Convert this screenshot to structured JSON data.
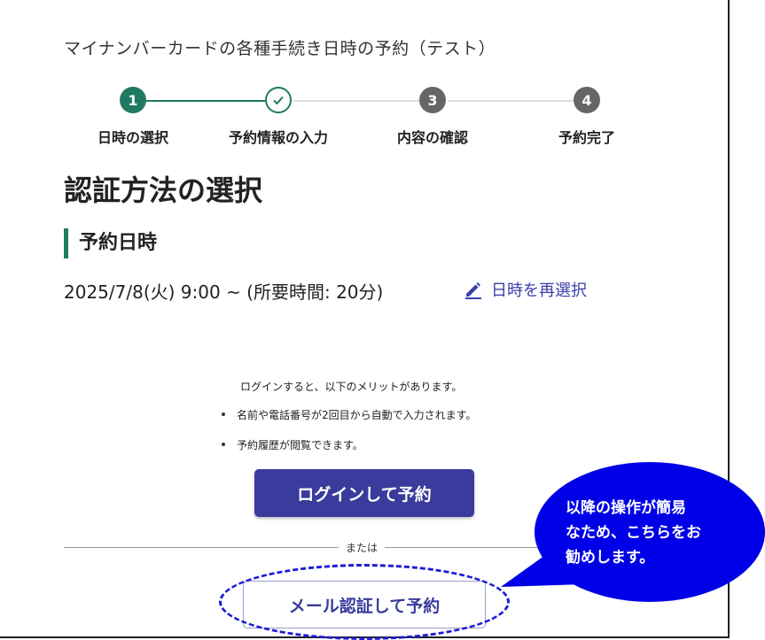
{
  "app": {
    "title": "マイナンバーカードの各種手続き日時の予約（テスト）"
  },
  "stepper": {
    "steps": [
      {
        "number": "1",
        "label": "日時の選択",
        "state": "current"
      },
      {
        "number": "",
        "label": "予約情報の入力",
        "state": "completed"
      },
      {
        "number": "3",
        "label": "内容の確認",
        "state": "upcoming"
      },
      {
        "number": "4",
        "label": "予約完了",
        "state": "upcoming"
      }
    ],
    "colors": {
      "active": "#1f7a63",
      "upcoming": "#666666",
      "line_inactive": "#dddddd"
    }
  },
  "page": {
    "heading": "認証方法の選択"
  },
  "reservation": {
    "section_title": "予約日時",
    "datetime": "2025/7/8(火) 9:00 ~ (所要時間: 20分)",
    "reselect_label": "日時を再選択"
  },
  "benefits": {
    "intro": "ログインすると、以下のメリットがあります。",
    "items": [
      "名前や電話番号が2回目から自動で入力されます。",
      "予約履歴が閲覧できます。"
    ]
  },
  "actions": {
    "login_label": "ログインして予約",
    "divider_label": "または",
    "mail_label": "メール認証して予約"
  },
  "annotation": {
    "callout_text": "以降の操作が簡易\nなため、こちらをお\n勧めします。",
    "callout_color": "#0000e6"
  }
}
